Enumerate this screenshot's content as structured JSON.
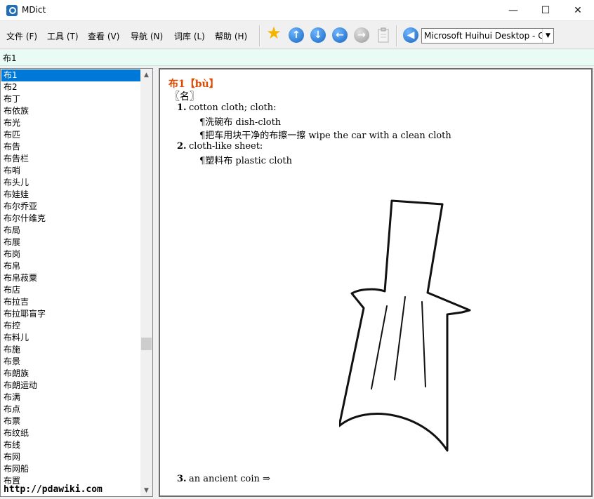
{
  "window": {
    "title": "MDict",
    "minimize": "—",
    "maximize": "☐",
    "close": "✕"
  },
  "menu": [
    "文件 (F)",
    "工具 (T)",
    "查看 (V)",
    "导航 (N)",
    "词库 (L)",
    "帮助 (H)"
  ],
  "toolbar": {
    "favorite_icon": "star-icon",
    "up_icon": "arrow-up-icon",
    "down_icon": "arrow-down-icon",
    "back_icon": "arrow-left-icon",
    "forward_icon": "arrow-right-icon",
    "clipboard_icon": "clipboard-icon",
    "speak_icon": "speaker-icon",
    "voice_selected": "Microsoft Huihui Desktop - C"
  },
  "search": {
    "value": "布1"
  },
  "wordlist": {
    "selected_index": 0,
    "items": [
      "布1",
      "布2",
      "布丁",
      "布依族",
      "布光",
      "布匹",
      "布告",
      "布告栏",
      "布哨",
      "布头儿",
      "布娃娃",
      "布尔乔亚",
      "布尔什维克",
      "布局",
      "布展",
      "布岗",
      "布帛",
      "布帛菽粟",
      "布店",
      "布拉吉",
      "布拉耶盲字",
      "布控",
      "布料儿",
      "布施",
      "布景",
      "布朗族",
      "布朗运动",
      "布满",
      "布点",
      "布票",
      "布纹纸",
      "布线",
      "布网",
      "布网船",
      "布置"
    ],
    "watermark": "http://pdawiki.com"
  },
  "entry": {
    "headword": "布1【bù】",
    "pos": "〖名〗",
    "senses": [
      {
        "num": "1.",
        "text": "cotton cloth; cloth:",
        "examples": [
          "¶洗碗布 dish-cloth",
          "¶把车用块干净的布擦一擦 wipe the car with a clean cloth"
        ]
      },
      {
        "num": "2.",
        "text": "cloth-like sheet:",
        "examples": [
          "¶塑料布 plastic cloth"
        ]
      },
      {
        "num": "3.",
        "text": "an ancient coin ⇒",
        "examples": []
      }
    ]
  },
  "colors": {
    "headword": "#e04a00",
    "selection": "#0078d7",
    "search_bg": "#e8fbf4"
  }
}
